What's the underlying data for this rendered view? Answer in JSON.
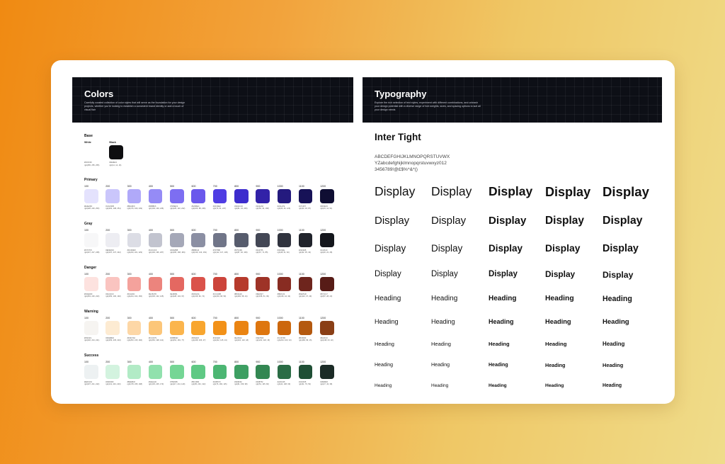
{
  "colors_panel": {
    "title": "Colors",
    "description": "Carefully curated collection of color styles that will serve as the foundation for your design projects, whether you're looking to establish a consistent brand identity or add a touch of visual flair",
    "base": {
      "title": "Base",
      "items": [
        {
          "label": "White",
          "hex": "#FFFFFF",
          "rgb": "rgb(255, 255, 255)"
        },
        {
          "label": "Black",
          "hex": "#0E0E10",
          "rgb": "rgb(14, 14, 16)"
        }
      ]
    },
    "groups": [
      {
        "title": "Primary",
        "steps": [
          "100",
          "200",
          "300",
          "400",
          "500",
          "600",
          "700",
          "800",
          "900",
          "1000",
          "1100",
          "1200"
        ],
        "hex": [
          "#E4E2FD",
          "#CAC6FB",
          "#B0A9F9",
          "#958BF6",
          "#7D6EF2",
          "#6A58EC",
          "#4F3DE3",
          "#3D2CCD",
          "#3222A8",
          "#241A7E",
          "#171257",
          "#0F0E33"
        ],
        "rgb": [
          "rgb(228, 226, 253)",
          "rgb(202, 198, 251)",
          "rgb(176, 169, 249)",
          "rgb(149, 139, 246)",
          "rgb(125, 110, 242)",
          "rgb(106, 88, 236)",
          "rgb(79, 61, 227)",
          "rgb(61, 44, 205)",
          "rgb(50, 34, 168)",
          "rgb(36, 26, 126)",
          "rgb(23, 18, 87)",
          "rgb(15, 14, 51)"
        ]
      },
      {
        "title": "Gray",
        "steps": [
          "100",
          "200",
          "300",
          "400",
          "500",
          "600",
          "700",
          "800",
          "900",
          "1000",
          "1100",
          "1200"
        ],
        "hex": [
          "#F7F7F8",
          "#EDEDF2",
          "#DCDDE5",
          "#C2C4CF",
          "#A5A8B8",
          "#8B8FA3",
          "#707588",
          "#575C6D",
          "#434755",
          "#30333E",
          "#20232B",
          "#14161C"
        ],
        "rgb": [
          "rgb(247, 247, 248)",
          "rgb(237, 237, 242)",
          "rgb(220, 221, 229)",
          "rgb(194, 196, 207)",
          "rgb(165, 168, 184)",
          "rgb(139, 143, 163)",
          "rgb(112, 117, 136)",
          "rgb(87, 92, 109)",
          "rgb(67, 71, 85)",
          "rgb(48, 51, 62)",
          "rgb(32, 35, 43)",
          "rgb(20, 22, 28)"
        ]
      },
      {
        "title": "Danger",
        "steps": [
          "100",
          "200",
          "300",
          "400",
          "500",
          "600",
          "700",
          "800",
          "900",
          "1000",
          "1100",
          "1200"
        ],
        "hex": [
          "#FDE2DF",
          "#FAC4C0",
          "#F4A29C",
          "#EC847D",
          "#E46861",
          "#DA524A",
          "#CC443B",
          "#B63A2C",
          "#9E3327",
          "#882C22",
          "#6E251D",
          "#571C17"
        ],
        "rgb": [
          "rgb(253, 226, 223)",
          "rgb(250, 196, 192)",
          "rgb(244, 162, 156)",
          "rgb(236, 132, 125)",
          "rgb(228, 104, 97)",
          "rgb(218, 82, 74)",
          "rgb(204, 68, 59)",
          "rgb(182, 58, 44)",
          "rgb(158, 51, 39)",
          "rgb(136, 44, 34)",
          "rgb(110, 37, 29)",
          "rgb(87, 28, 23)"
        ]
      },
      {
        "title": "Warning",
        "steps": [
          "100",
          "200",
          "300",
          "400",
          "500",
          "600",
          "700",
          "800",
          "900",
          "1000",
          "1100",
          "1200"
        ],
        "hex": [
          "#F6F4F1",
          "#FDEBD2",
          "#FDD7A6",
          "#FCC679",
          "#FBB54D",
          "#F8A62F",
          "#F29118",
          "#EA8412",
          "#DE760F",
          "#CC670D",
          "#B4590F",
          "#8A3F16"
        ],
        "rgb": [
          "rgb(246, 244, 241)",
          "rgb(253, 235, 210)",
          "rgb(253, 215, 166)",
          "rgb(252, 198, 121)",
          "rgb(251, 181, 77)",
          "rgb(248, 166, 47)",
          "rgb(242, 145, 24)",
          "rgb(234, 132, 18)",
          "rgb(222, 118, 15)",
          "rgb(204, 103, 13)",
          "rgb(180, 89, 15)",
          "rgb(138, 63, 22)"
        ]
      },
      {
        "title": "Success",
        "steps": [
          "100",
          "200",
          "300",
          "400",
          "500",
          "600",
          "700",
          "800",
          "900",
          "1000",
          "1100",
          "1200"
        ],
        "hex": [
          "#EDF1F2",
          "#D3F3DF",
          "#B2EBC6",
          "#91E1AD",
          "#75D695",
          "#5FC984",
          "#4CB673",
          "#3D9F62",
          "#338752",
          "#2A6C45",
          "#1F4F35",
          "#1B2B26"
        ],
        "rgb": [
          "rgb(237, 241, 242)",
          "rgb(211, 243, 223)",
          "rgb(178, 235, 198)",
          "rgb(145, 225, 173)",
          "rgb(117, 214, 149)",
          "rgb(95, 201, 132)",
          "rgb(76, 182, 115)",
          "rgb(61, 159, 98)",
          "rgb(51, 135, 82)",
          "rgb(42, 108, 69)",
          "rgb(31, 79, 53)",
          "rgb(27, 43, 38)"
        ]
      }
    ]
  },
  "typography_panel": {
    "title": "Typography",
    "description": "Explore the rich selection of text styles, experiment with different combinations, and unleash your design potential with a diverse range of font weights, sizes, and spacing options to suit all your design needs",
    "font_name": "Inter Tight",
    "alphabet": [
      "ABCDEFGHIJKLMNOPQRSTUVWX",
      "YZabcdefghijklmnopqrstuvwxyz012",
      "3456789!@£$%^&*()"
    ],
    "rows": [
      {
        "text": "Display"
      },
      {
        "text": "Display"
      },
      {
        "text": "Display"
      },
      {
        "text": "Display"
      },
      {
        "text": "Heading"
      },
      {
        "text": "Heading"
      },
      {
        "text": "Heading"
      },
      {
        "text": "Heading"
      },
      {
        "text": "Heading"
      }
    ]
  }
}
